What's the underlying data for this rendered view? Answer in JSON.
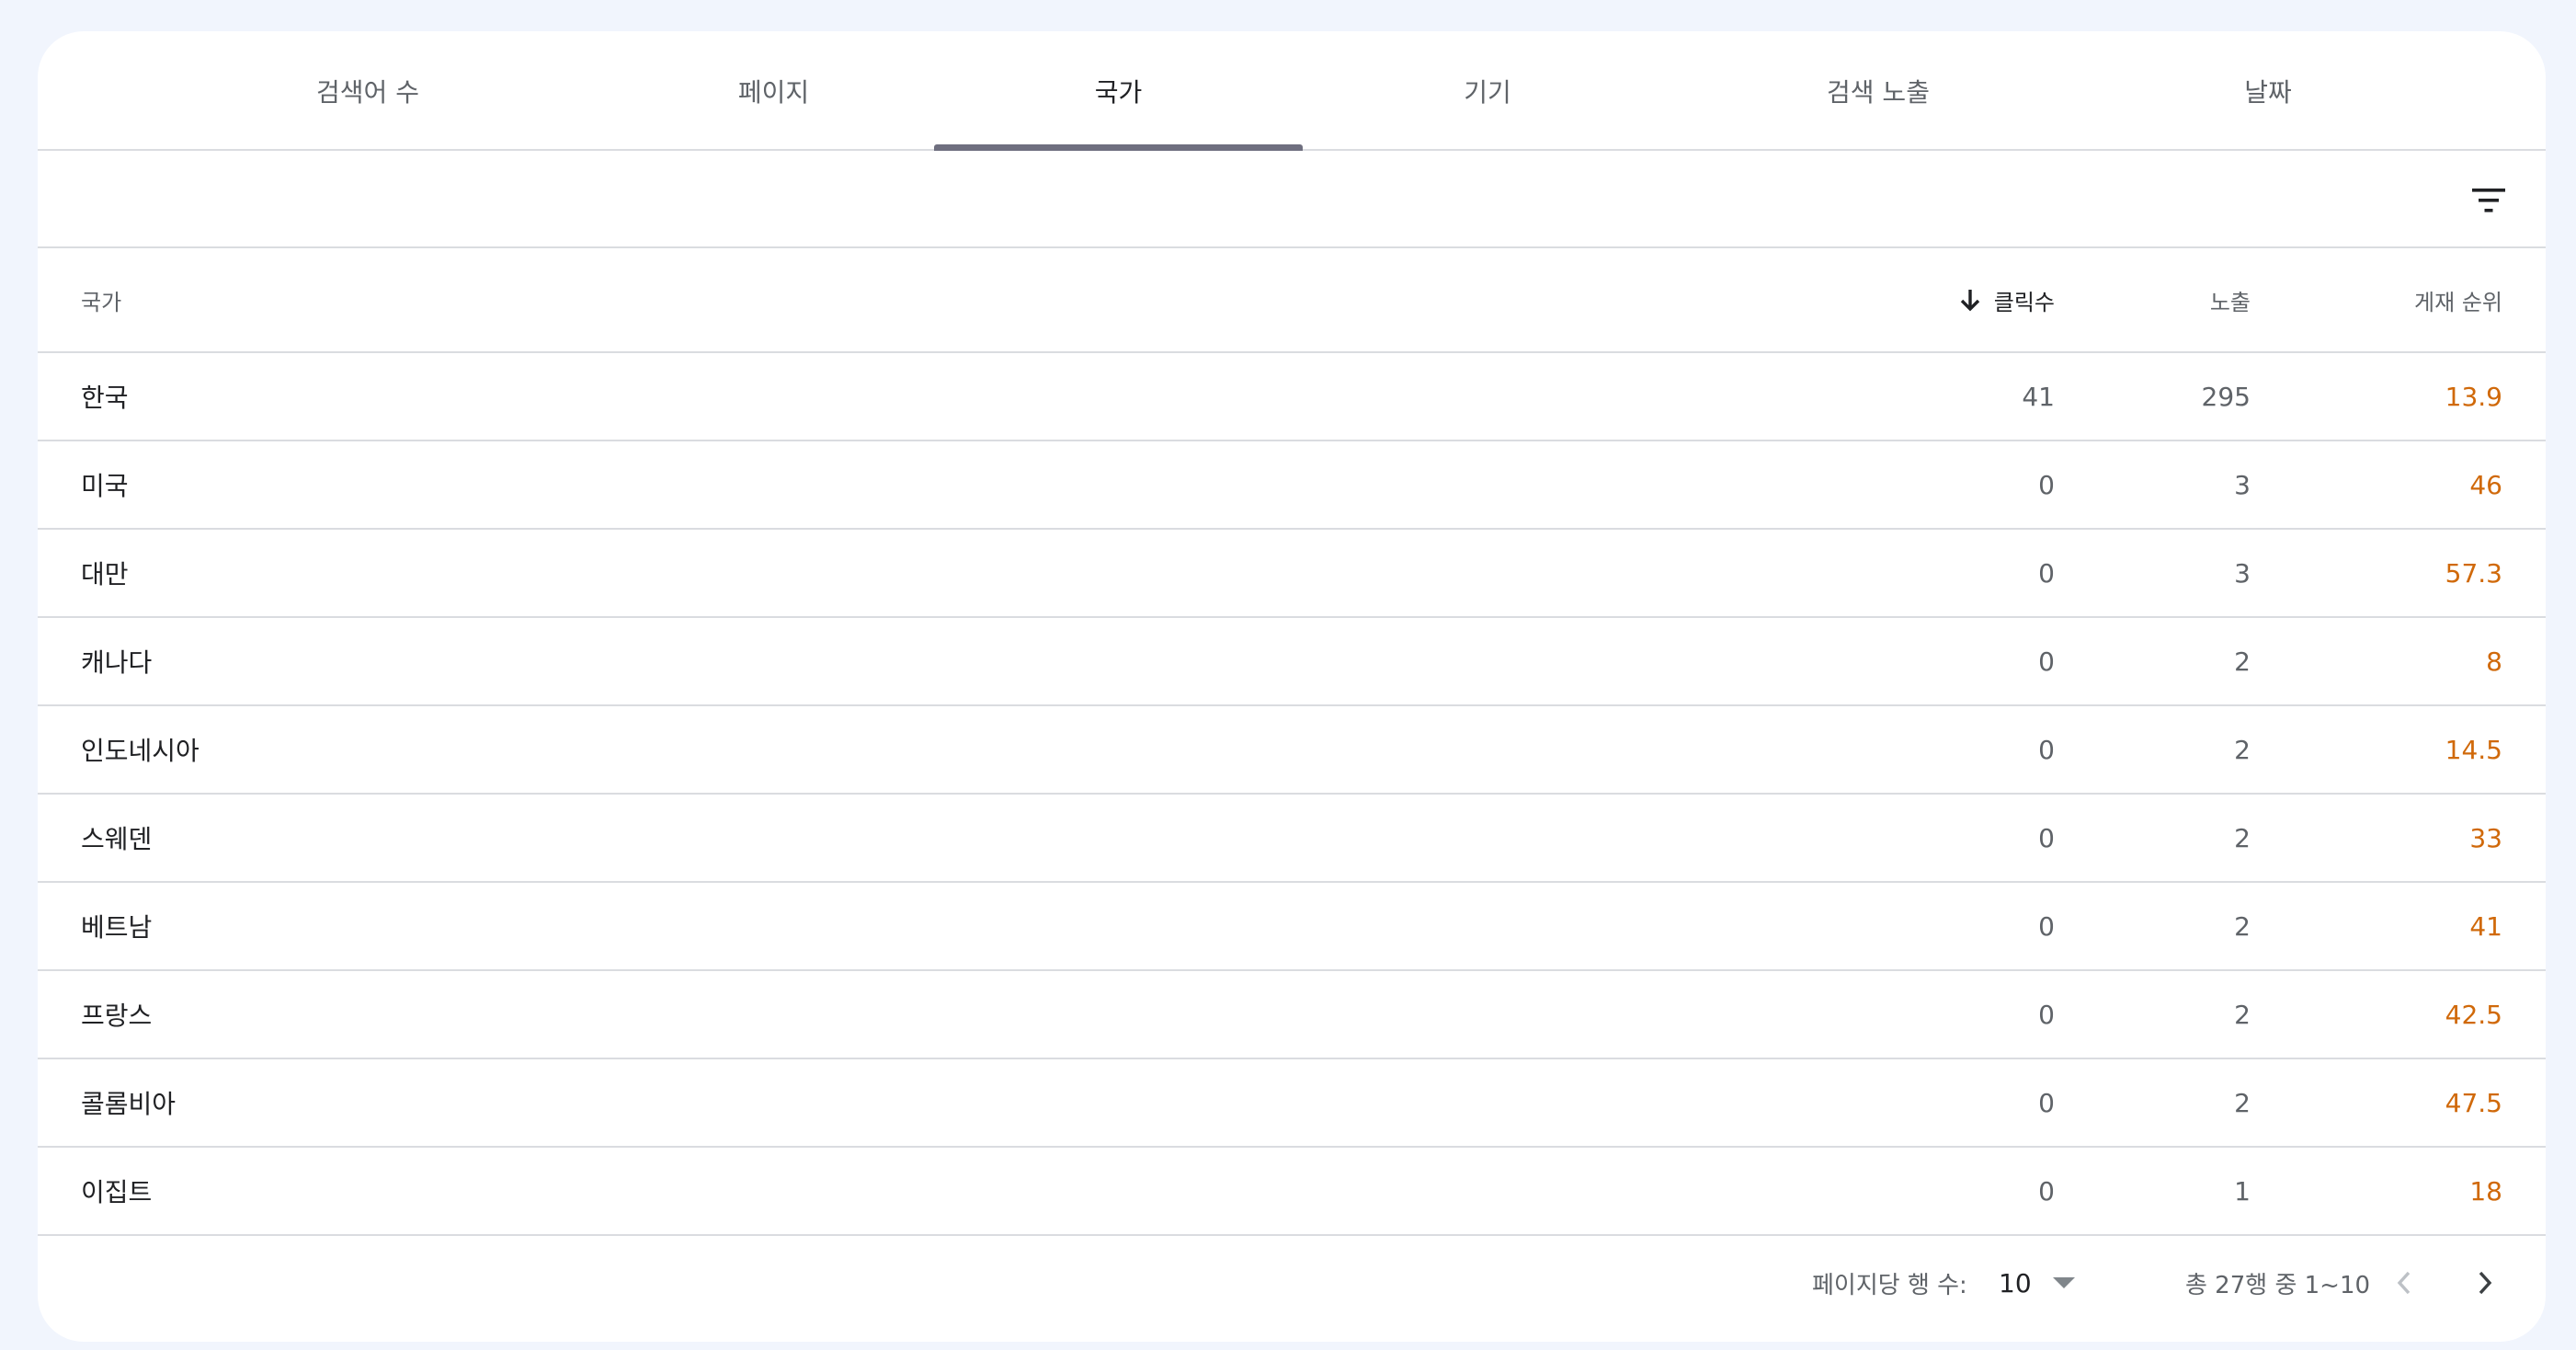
{
  "tabs": [
    {
      "label": "검색어 수"
    },
    {
      "label": "페이지"
    },
    {
      "label": "국가"
    },
    {
      "label": "기기"
    },
    {
      "label": "검색 노출"
    },
    {
      "label": "날짜"
    }
  ],
  "active_tab": "국가",
  "colors": {
    "position": "#d0690a",
    "indicator": "#6f6f7f",
    "page_bg": "#f1f5fd"
  },
  "icons": {
    "filter": "filter-icon",
    "sort": "arrow-down-icon",
    "dropdown": "caret-down-icon",
    "prev": "chevron-left-icon",
    "next": "chevron-right-icon"
  },
  "table": {
    "headers": {
      "country": "국가",
      "clicks": "클릭수",
      "impressions": "노출",
      "position": "게재 순위"
    },
    "rows": [
      {
        "country": "한국",
        "clicks": "41",
        "impressions": "295",
        "position": "13.9"
      },
      {
        "country": "미국",
        "clicks": "0",
        "impressions": "3",
        "position": "46"
      },
      {
        "country": "대만",
        "clicks": "0",
        "impressions": "3",
        "position": "57.3"
      },
      {
        "country": "캐나다",
        "clicks": "0",
        "impressions": "2",
        "position": "8"
      },
      {
        "country": "인도네시아",
        "clicks": "0",
        "impressions": "2",
        "position": "14.5"
      },
      {
        "country": "스웨덴",
        "clicks": "0",
        "impressions": "2",
        "position": "33"
      },
      {
        "country": "베트남",
        "clicks": "0",
        "impressions": "2",
        "position": "41"
      },
      {
        "country": "프랑스",
        "clicks": "0",
        "impressions": "2",
        "position": "42.5"
      },
      {
        "country": "콜롬비아",
        "clicks": "0",
        "impressions": "2",
        "position": "47.5"
      },
      {
        "country": "이집트",
        "clicks": "0",
        "impressions": "1",
        "position": "18"
      }
    ]
  },
  "pagination": {
    "rows_per_page_label": "페이지당 행 수:",
    "rows_per_page_value": "10",
    "range_text": "총 27행 중 1~10"
  }
}
